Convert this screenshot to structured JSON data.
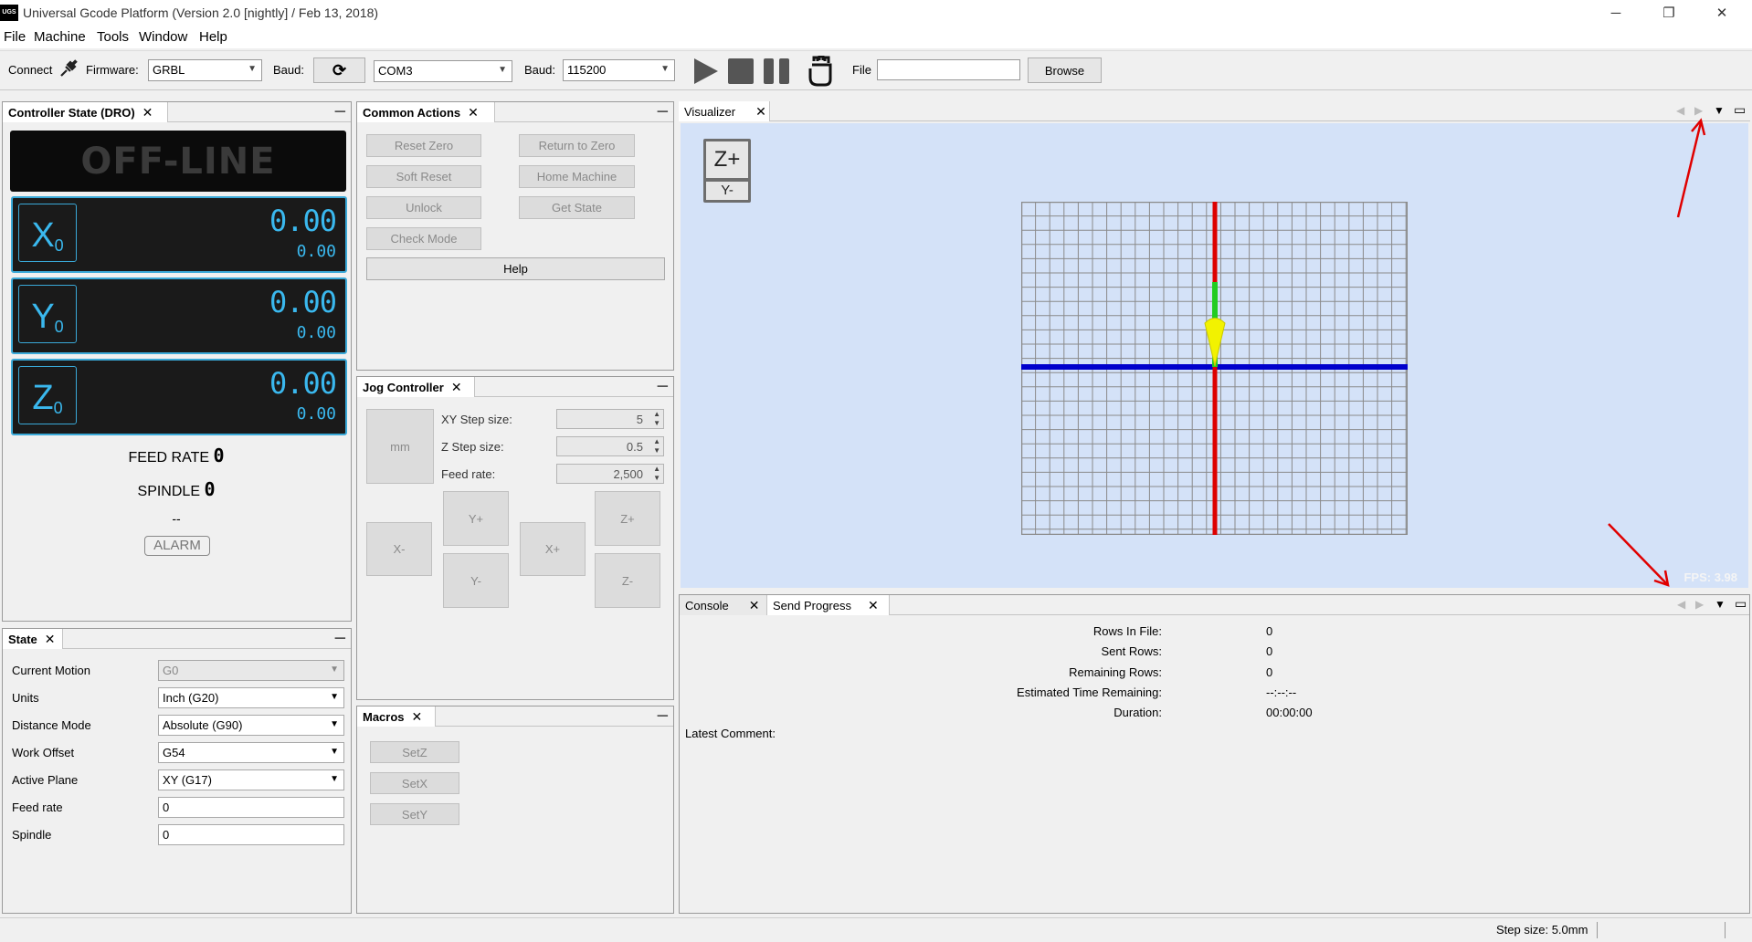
{
  "window": {
    "logo_text": "UGS",
    "title": "Universal Gcode Platform (Version 2.0 [nightly]  / Feb 13, 2018)",
    "min_glyph": "─",
    "max_glyph": "❐",
    "close_glyph": "✕"
  },
  "menu": [
    "File",
    "Machine",
    "Tools",
    "Window",
    "Help"
  ],
  "toolbar": {
    "connect_label": "Connect",
    "firmware_label": "Firmware:",
    "firmware_value": "GRBL",
    "baud_label_1": "Baud:",
    "port_value": "COM3",
    "baud_label_2": "Baud:",
    "baud_value": "115200",
    "file_label": "File",
    "file_value": "",
    "browse_label": "Browse"
  },
  "dro": {
    "tab_label": "Controller State (DRO)",
    "status": "OFF-LINE",
    "axes": [
      {
        "letter": "X",
        "sub": "0",
        "work": "0.00",
        "machine": "0.00"
      },
      {
        "letter": "Y",
        "sub": "0",
        "work": "0.00",
        "machine": "0.00"
      },
      {
        "letter": "Z",
        "sub": "0",
        "work": "0.00",
        "machine": "0.00"
      }
    ],
    "feed_rate_label": "FEED RATE",
    "feed_rate_value": "0",
    "spindle_label": "SPINDLE",
    "spindle_value": "0",
    "pins": "--",
    "alarm_label": "ALARM"
  },
  "common_actions": {
    "tab_label": "Common Actions",
    "buttons": [
      "Reset Zero",
      "Return to Zero",
      "Soft Reset",
      "Home Machine",
      "Unlock",
      "Get State",
      "Check Mode"
    ],
    "help_label": "Help"
  },
  "jog": {
    "tab_label": "Jog Controller",
    "unit_button": "mm",
    "xy_step_label": "XY Step size:",
    "xy_step_value": "5",
    "z_step_label": "Z Step size:",
    "z_step_value": "0.5",
    "feed_label": "Feed rate:",
    "feed_value": "2,500",
    "x_minus": "X-",
    "y_plus": "Y+",
    "y_minus": "Y-",
    "x_plus": "X+",
    "z_plus": "Z+",
    "z_minus": "Z-"
  },
  "macros": {
    "tab_label": "Macros",
    "buttons": [
      "SetZ",
      "SetX",
      "SetY"
    ]
  },
  "state": {
    "tab_label": "State",
    "rows": [
      {
        "label": "Current Motion",
        "value": "G0"
      },
      {
        "label": "Units",
        "value": "Inch (G20)"
      },
      {
        "label": "Distance Mode",
        "value": "Absolute (G90)"
      },
      {
        "label": "Work Offset",
        "value": "G54"
      },
      {
        "label": "Active Plane",
        "value": "XY (G17)"
      },
      {
        "label": "Feed rate",
        "value": "0"
      },
      {
        "label": "Spindle",
        "value": "0"
      }
    ]
  },
  "visualizer": {
    "tab_label": "Visualizer",
    "view_top": "Z+",
    "view_bottom": "Y-",
    "fps": "FPS: 3.98",
    "colors": {
      "x_axis": "#0000cc",
      "y_axis": "#dd0000",
      "z_axis": "#22cc22",
      "tool": "#f2f200",
      "background": "#d4e2f8"
    }
  },
  "bottom_tabs": {
    "console_label": "Console",
    "progress_label": "Send Progress"
  },
  "progress": {
    "rows": [
      {
        "label": "Rows In File:",
        "value": "0"
      },
      {
        "label": "Sent Rows:",
        "value": "0"
      },
      {
        "label": "Remaining Rows:",
        "value": "0"
      },
      {
        "label": "Estimated Time Remaining:",
        "value": "--:--:--"
      },
      {
        "label": "Duration:",
        "value": "00:00:00"
      }
    ],
    "latest_comment_label": "Latest Comment:"
  },
  "statusbar": {
    "step_size": "Step size: 5.0mm"
  }
}
